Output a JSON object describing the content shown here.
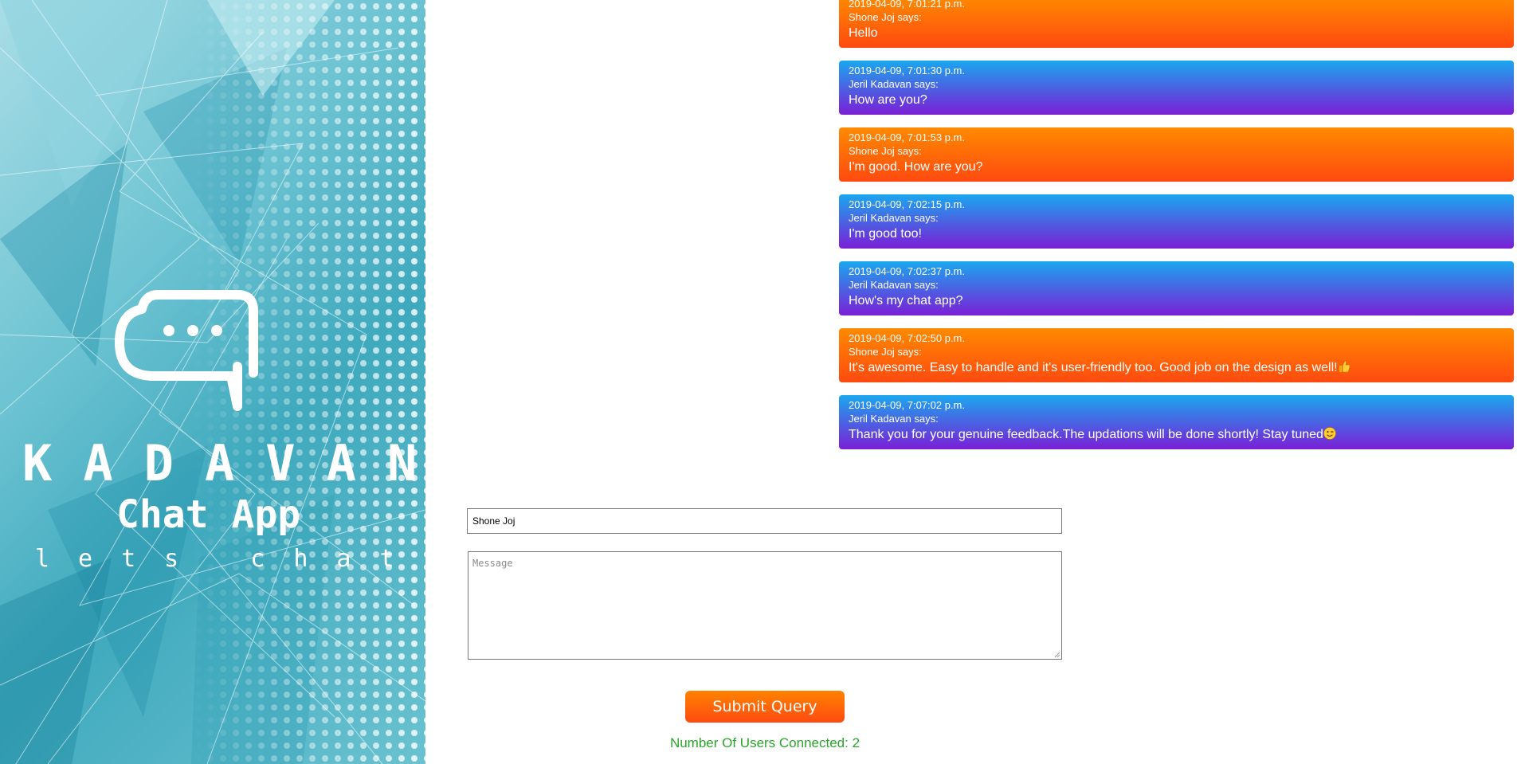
{
  "brand": {
    "name": "KADAVAN",
    "subtitle": "Chat App",
    "tagline": "lets chat",
    "logo_icon": "chat-bubble-icon"
  },
  "messages": [
    {
      "time": "2019-04-09, 7:01:21 p.m.",
      "author": "Shone Joj says:",
      "text": "Hello",
      "style": "orange"
    },
    {
      "time": "2019-04-09, 7:01:30 p.m.",
      "author": "Jeril Kadavan says:",
      "text": "How are you?",
      "style": "blue"
    },
    {
      "time": "2019-04-09, 7:01:53 p.m.",
      "author": "Shone Joj says:",
      "text": "I'm good. How are you?",
      "style": "orange"
    },
    {
      "time": "2019-04-09, 7:02:15 p.m.",
      "author": "Jeril Kadavan says:",
      "text": "I'm good too!",
      "style": "blue"
    },
    {
      "time": "2019-04-09, 7:02:37 p.m.",
      "author": "Jeril Kadavan says:",
      "text": "How's my chat app?",
      "style": "blue"
    },
    {
      "time": "2019-04-09, 7:02:50 p.m.",
      "author": "Shone Joj says:",
      "text": "It's awesome. Easy to handle and it's user-friendly too. Good job on the design as well!",
      "style": "orange",
      "emoji": "thumbs-up-icon"
    },
    {
      "time": "2019-04-09, 7:07:02 p.m.",
      "author": "Jeril Kadavan says:",
      "text": "Thank you for your genuine feedback.The updations will be done shortly! Stay tuned",
      "style": "blue",
      "emoji": "wink-face-icon"
    }
  ],
  "form": {
    "name_value": "Shone Joj",
    "message_placeholder": "Message",
    "submit_label": "Submit Query"
  },
  "status": {
    "users_connected": "Number Of Users Connected: 2"
  },
  "colors": {
    "orange_top": "#ff8a00",
    "orange_bottom": "#ff4a10",
    "blue_top": "#1aa7ef",
    "blue_bottom": "#7a1fd6",
    "status_green": "#2aa52a"
  }
}
